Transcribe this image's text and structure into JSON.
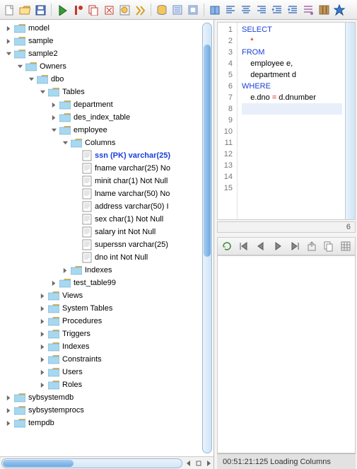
{
  "toolbar_icons": [
    "new-doc",
    "folder-open",
    "save",
    "sep",
    "sql-run",
    "sql-commit",
    "sql-copy",
    "sql-rollback",
    "sql-cancel",
    "sql-explain",
    "sep",
    "db",
    "pref1",
    "pref2",
    "sep",
    "book",
    "align-left",
    "align-center",
    "align-right",
    "indent-dec",
    "indent-inc",
    "format",
    "columns",
    "star"
  ],
  "tree": [
    {
      "d": 0,
      "a": "r",
      "t": "folder",
      "l": "model"
    },
    {
      "d": 0,
      "a": "r",
      "t": "folder",
      "l": "sample"
    },
    {
      "d": 0,
      "a": "d",
      "t": "folder",
      "l": "sample2"
    },
    {
      "d": 1,
      "a": "d",
      "t": "folder",
      "l": "Owners"
    },
    {
      "d": 2,
      "a": "d",
      "t": "folder",
      "l": "dbo"
    },
    {
      "d": 3,
      "a": "d",
      "t": "folder",
      "l": "Tables"
    },
    {
      "d": 4,
      "a": "r",
      "t": "folder",
      "l": "department"
    },
    {
      "d": 4,
      "a": "r",
      "t": "folder",
      "l": "des_index_table"
    },
    {
      "d": 4,
      "a": "d",
      "t": "folder",
      "l": "employee"
    },
    {
      "d": 5,
      "a": "d",
      "t": "folder",
      "l": "Columns"
    },
    {
      "d": 6,
      "a": "",
      "t": "doc",
      "l": "ssn (PK) varchar(25)",
      "pk": true
    },
    {
      "d": 6,
      "a": "",
      "t": "doc",
      "l": "fname varchar(25) No"
    },
    {
      "d": 6,
      "a": "",
      "t": "doc",
      "l": "minit char(1) Not Null"
    },
    {
      "d": 6,
      "a": "",
      "t": "doc",
      "l": "lname varchar(50) No"
    },
    {
      "d": 6,
      "a": "",
      "t": "doc",
      "l": "address varchar(50) I"
    },
    {
      "d": 6,
      "a": "",
      "t": "doc",
      "l": "sex char(1) Not Null"
    },
    {
      "d": 6,
      "a": "",
      "t": "doc",
      "l": "salary int Not Null"
    },
    {
      "d": 6,
      "a": "",
      "t": "doc",
      "l": "superssn varchar(25) "
    },
    {
      "d": 6,
      "a": "",
      "t": "doc",
      "l": "dno int Not Null"
    },
    {
      "d": 5,
      "a": "r",
      "t": "folder",
      "l": "Indexes"
    },
    {
      "d": 4,
      "a": "r",
      "t": "folder",
      "l": "test_table99"
    },
    {
      "d": 3,
      "a": "r",
      "t": "folder",
      "l": "Views"
    },
    {
      "d": 3,
      "a": "r",
      "t": "folder",
      "l": "System Tables"
    },
    {
      "d": 3,
      "a": "r",
      "t": "folder",
      "l": "Procedures"
    },
    {
      "d": 3,
      "a": "r",
      "t": "folder",
      "l": "Triggers"
    },
    {
      "d": 3,
      "a": "r",
      "t": "folder",
      "l": "Indexes"
    },
    {
      "d": 3,
      "a": "r",
      "t": "folder",
      "l": "Constraints"
    },
    {
      "d": 3,
      "a": "r",
      "t": "folder",
      "l": "Users"
    },
    {
      "d": 3,
      "a": "r",
      "t": "folder",
      "l": "Roles"
    },
    {
      "d": 0,
      "a": "r",
      "t": "folder",
      "l": "sybsystemdb"
    },
    {
      "d": 0,
      "a": "r",
      "t": "folder",
      "l": "sybsystemprocs"
    },
    {
      "d": 0,
      "a": "r",
      "t": "folder",
      "l": "tempdb"
    }
  ],
  "sql": {
    "lines": [
      {
        "n": "1",
        "seg": [
          {
            "c": "kw",
            "t": "SELECT"
          }
        ]
      },
      {
        "n": "2",
        "seg": [
          {
            "c": "",
            "t": "    "
          },
          {
            "c": "s-star",
            "t": "*"
          }
        ]
      },
      {
        "n": "3",
        "seg": [
          {
            "c": "kw",
            "t": "FROM"
          }
        ]
      },
      {
        "n": "4",
        "seg": [
          {
            "c": "",
            "t": "    employee e,"
          }
        ]
      },
      {
        "n": "5",
        "seg": [
          {
            "c": "",
            "t": "    department d"
          }
        ]
      },
      {
        "n": "6",
        "seg": [
          {
            "c": "kw",
            "t": "WHERE"
          }
        ]
      },
      {
        "n": "7",
        "seg": [
          {
            "c": "",
            "t": "    e.dno "
          },
          {
            "c": "s-star",
            "t": "="
          },
          {
            "c": "",
            "t": " d.dnumber"
          }
        ]
      },
      {
        "n": "8",
        "seg": [],
        "cur": true
      },
      {
        "n": "9",
        "seg": []
      },
      {
        "n": "10",
        "seg": []
      },
      {
        "n": "11",
        "seg": []
      },
      {
        "n": "12",
        "seg": []
      },
      {
        "n": "13",
        "seg": []
      },
      {
        "n": "14",
        "seg": []
      },
      {
        "n": "15",
        "seg": []
      }
    ],
    "hscroll_label": "6"
  },
  "results_icons": [
    "refresh",
    "nav-first",
    "nav-prev",
    "nav-next",
    "nav-last",
    "export",
    "copy",
    "grid"
  ],
  "status": "00:51:21:125 Loading Columns"
}
